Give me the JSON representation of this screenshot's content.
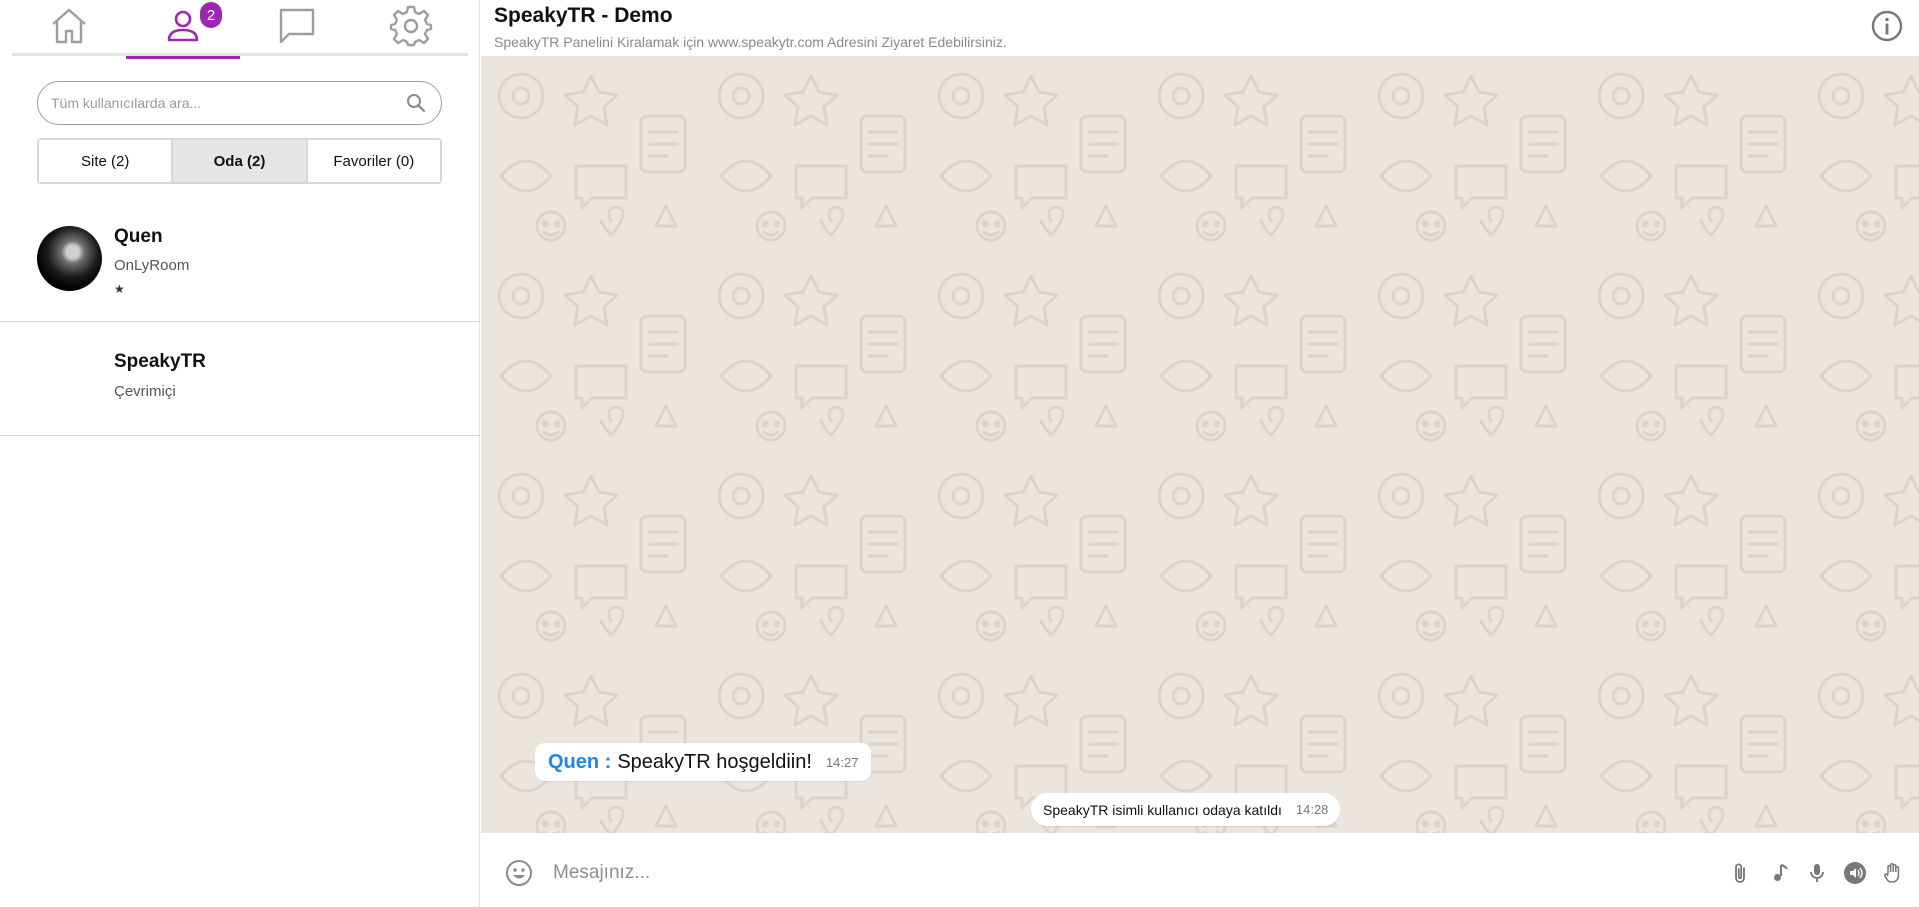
{
  "sidebar": {
    "tabs": [
      {
        "name": "home-icon"
      },
      {
        "name": "user-icon",
        "badge": "2"
      },
      {
        "name": "chat-bubble-icon"
      },
      {
        "name": "gear-icon"
      }
    ],
    "search": {
      "placeholder": "Tüm kullanıcılarda ara..."
    },
    "filters": [
      "Site (2)",
      "Oda (2)",
      "Favoriler (0)"
    ],
    "active_filter": "Oda (2)",
    "users": [
      {
        "name": "Quen",
        "status": "OnLyRoom",
        "mark": "★"
      },
      {
        "name": "SpeakyTR",
        "status": "Çevrimiçi"
      }
    ]
  },
  "header": {
    "title": "SpeakyTR - Demo",
    "subtitle": "SpeakyTR Panelini Kiralamak için www.speakytr.com Adresini Ziyaret Edebilirsiniz."
  },
  "messages": [
    {
      "sender": "Quen :",
      "text": "SpeakyTR hoşgeldiin!",
      "time": "14:27"
    },
    {
      "text": "SpeakyTR isimli kullanıcı odaya katıldı",
      "time": "14:28"
    }
  ],
  "composer": {
    "placeholder": "Mesajınız..."
  },
  "colors": {
    "accent": "#9c27b0",
    "sender": "#1e88e5",
    "chat_bg": "#ece5dd"
  }
}
